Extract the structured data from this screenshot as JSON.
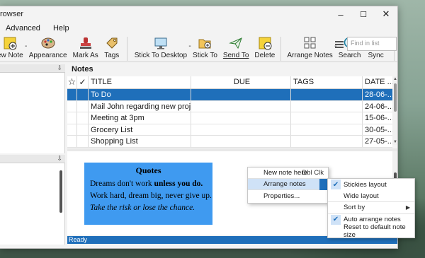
{
  "app": {
    "title": "rowser"
  },
  "menubar": [
    "Advanced",
    "Help"
  ],
  "window_controls": {
    "minimize": "–",
    "maximize": "☐",
    "close": "✕"
  },
  "toolbar": {
    "new_note": "ew Note",
    "appearance": "Appearance",
    "mark_as": "Mark As",
    "tags": "Tags",
    "stick_to_desktop": "Stick To Desktop",
    "stick_to": "Stick To",
    "send_to": "Send To",
    "delete": "Delete",
    "arrange_notes": "Arrange Notes",
    "search": "Search",
    "sync": "Sync",
    "search_placeholder": "Find in list"
  },
  "notes": {
    "title": "Notes",
    "columns": {
      "title": "TITLE",
      "due": "DUE",
      "tags": "TAGS",
      "date": "DATE ..."
    },
    "rows": [
      {
        "title": "To Do",
        "due": "",
        "tags": "",
        "date": "28-06-..."
      },
      {
        "title": "Mail John regarding new project",
        "due": "",
        "tags": "",
        "date": "24-06-..."
      },
      {
        "title": "Meeting at 3pm",
        "due": "",
        "tags": "",
        "date": "15-06-..."
      },
      {
        "title": "Grocery List",
        "due": "",
        "tags": "",
        "date": "30-05-..."
      },
      {
        "title": "Shopping List",
        "due": "",
        "tags": "",
        "date": "27-05-..."
      }
    ]
  },
  "sticky": {
    "title": "Quotes",
    "line1_a": "Dreams don't work ",
    "line1_b": "unless you do.",
    "line2": "Work hard, dream big, never give up.",
    "line3": "Take the risk or lose the chance."
  },
  "status": "Ready",
  "context_menu": {
    "new_note_here": "New note here",
    "new_note_shortcut": "Dbl Clk",
    "arrange_notes": "Arrange notes",
    "properties": "Properties..."
  },
  "submenu": {
    "stickies_layout": "Stickies layout",
    "wide_layout": "Wide layout",
    "sort_by": "Sort by",
    "auto_arrange": "Auto arrange notes",
    "reset_size": "Reset to default note size"
  },
  "colors": {
    "accent": "#1f6fba",
    "sticky": "#3f9af0"
  }
}
